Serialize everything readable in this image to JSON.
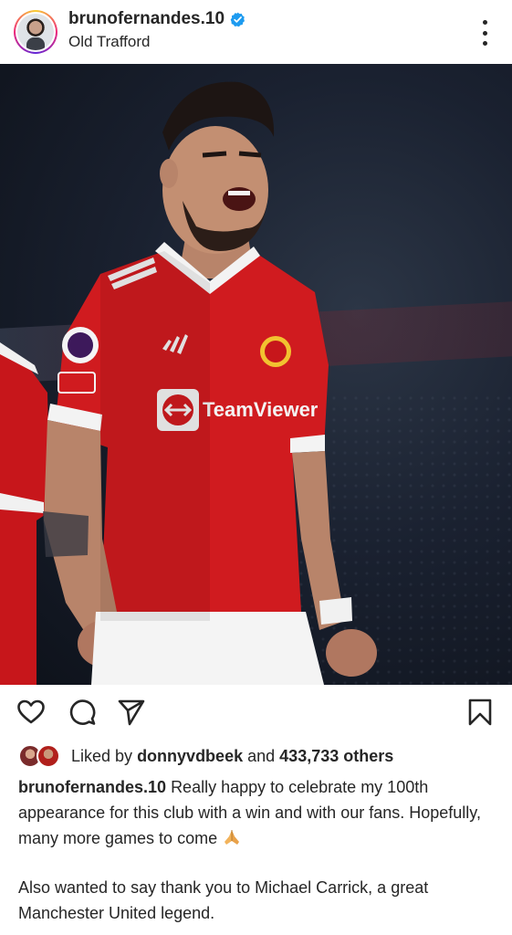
{
  "post": {
    "username": "brunofernandes.10",
    "location": "Old Trafford",
    "verified": true,
    "likes": {
      "prefix": "Liked by",
      "user": "donnyvdbeek",
      "connector": "and",
      "count_text": "433,733 others"
    },
    "caption": {
      "username": "brunofernandes.10",
      "paragraph1": "Really happy to celebrate my 100th appearance for this club with a win and with our fans. Hopefully, many more games to come",
      "paragraph2": "Also wanted to say thank you to Michael Carrick, a great Manchester United legend."
    },
    "photo": {
      "sponsor": "TeamViewer",
      "kit_brand": "adidas"
    }
  },
  "icons": {
    "like": "heart-icon",
    "comment": "comment-icon",
    "share": "send-icon",
    "save": "bookmark-icon",
    "more": "more-vertical-icon",
    "verified": "verified-badge-icon"
  },
  "colors": {
    "verified_blue": "#1d9bf0",
    "kit_red": "#d01b1f",
    "text": "#262626"
  }
}
